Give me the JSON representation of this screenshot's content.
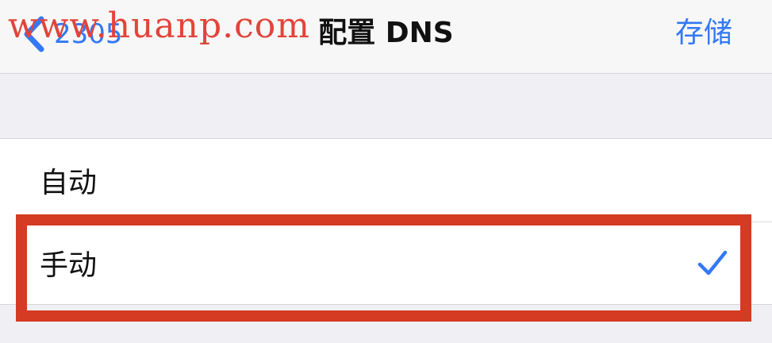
{
  "nav": {
    "back_label": "2305",
    "title": "配置 DNS",
    "save_label": "存储"
  },
  "watermark": "www.huanp.com",
  "options": [
    {
      "label": "自动",
      "selected": false
    },
    {
      "label": "手动",
      "selected": true
    }
  ],
  "colors": {
    "accent": "#3478f6",
    "highlight": "#d43b22",
    "watermark": "#e2443a"
  },
  "icons": {
    "back": "chevron-left-icon",
    "selected": "checkmark-icon"
  }
}
